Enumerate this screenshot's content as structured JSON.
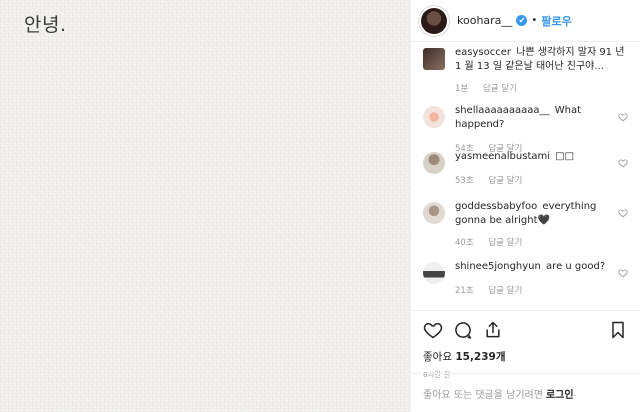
{
  "photo": {
    "caption_text": "안녕."
  },
  "header": {
    "username": "koohara__",
    "verified_symbol": "✔",
    "separator": "•",
    "follow_label": "팔로우"
  },
  "comments": [
    {
      "username": "easysoccer",
      "text": "나쁜 생각하지 말자 91 년 1 월 13 일 같은날 태어난 친구야...",
      "time": "1분",
      "reply_label": "답글 달기",
      "avatar": "photo-avatar"
    },
    {
      "username": "shellaaaaaaaaaa__",
      "text": "What happend?",
      "time": "54초",
      "reply_label": "답글 달기",
      "avatar": "pink-flower-avatar"
    },
    {
      "username": "yasmeenalbustami",
      "text": "□□",
      "time": "53초",
      "reply_label": "답글 달기",
      "avatar": "selfie-avatar"
    },
    {
      "username": "goddessbabyfoo",
      "text": "everything gonna be alright🖤",
      "time": "40초",
      "reply_label": "답글 달기",
      "avatar": "portrait-avatar"
    },
    {
      "username": "shinee5jonghyun",
      "text": "are u good?",
      "time": "21초",
      "reply_label": "답글 달기",
      "avatar": "group-avatar"
    }
  ],
  "actions": {
    "icons": [
      "heart-icon",
      "comment-icon",
      "share-icon",
      "bookmark-icon"
    ],
    "likes_prefix": "좋아요",
    "likes_count": "15,239개",
    "timestamp": "6시간 전"
  },
  "login": {
    "prompt": "좋아요 또는 댓글을 남기려면",
    "link_label": "로그인",
    "suffix": "."
  },
  "colors": {
    "accent": "#3897f0",
    "text": "#262626",
    "muted": "#999999",
    "border": "#efefef"
  }
}
